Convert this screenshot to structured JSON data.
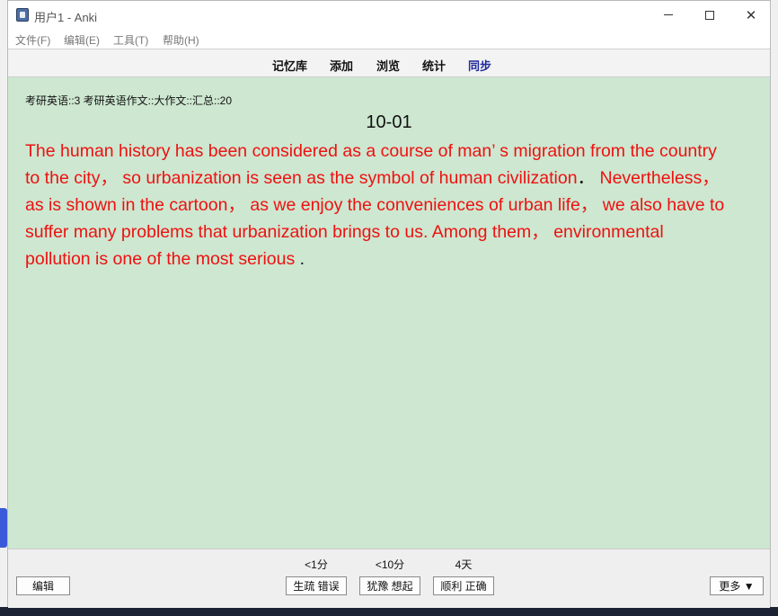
{
  "window": {
    "title": "用户1 - Anki",
    "minimize_glyph": "",
    "close_glyph": "✕"
  },
  "menu": [
    "文件(F)",
    "编辑(E)",
    "工具(T)",
    "帮助(H)"
  ],
  "toolbar": {
    "decks": "记忆库",
    "add": "添加",
    "browse": "浏览",
    "stats": "统计",
    "sync": "同步"
  },
  "card": {
    "deck_path": "考研英语::3 考研英语作文::大作文::汇总::20",
    "title": "10-01",
    "lines": [
      "  The human history has been considered as a course of man’ s migration from the country",
      "to the city，  so urbanization is seen as the symbol of human civilization",
      "as is shown in the cartoon，  as we enjoy the conveniences of urban life，  we also have to",
      "suffer many problems that urbanization brings to us.   Among them，  environmental",
      "pollution is one of the most serious"
    ],
    "line2_period": "．",
    "line2_tail": "     Nevertheless，",
    "line5_period": " ."
  },
  "answer_bar": {
    "edit_label": "编辑",
    "intervals": [
      "<1分",
      "<10分",
      "4天"
    ],
    "again_label": "生疏 错误",
    "hard_label": "犹豫 想起",
    "good_label": "顺利 正确",
    "more_label": "更多 ▼"
  },
  "colors": {
    "card_background": "#cde7d0",
    "card_text": "#ee1111",
    "sync_link": "#1f2a9a"
  },
  "icons": {
    "app": "anki-icon",
    "minimize": "minimize-icon",
    "maximize": "maximize-icon",
    "close": "close-icon"
  }
}
